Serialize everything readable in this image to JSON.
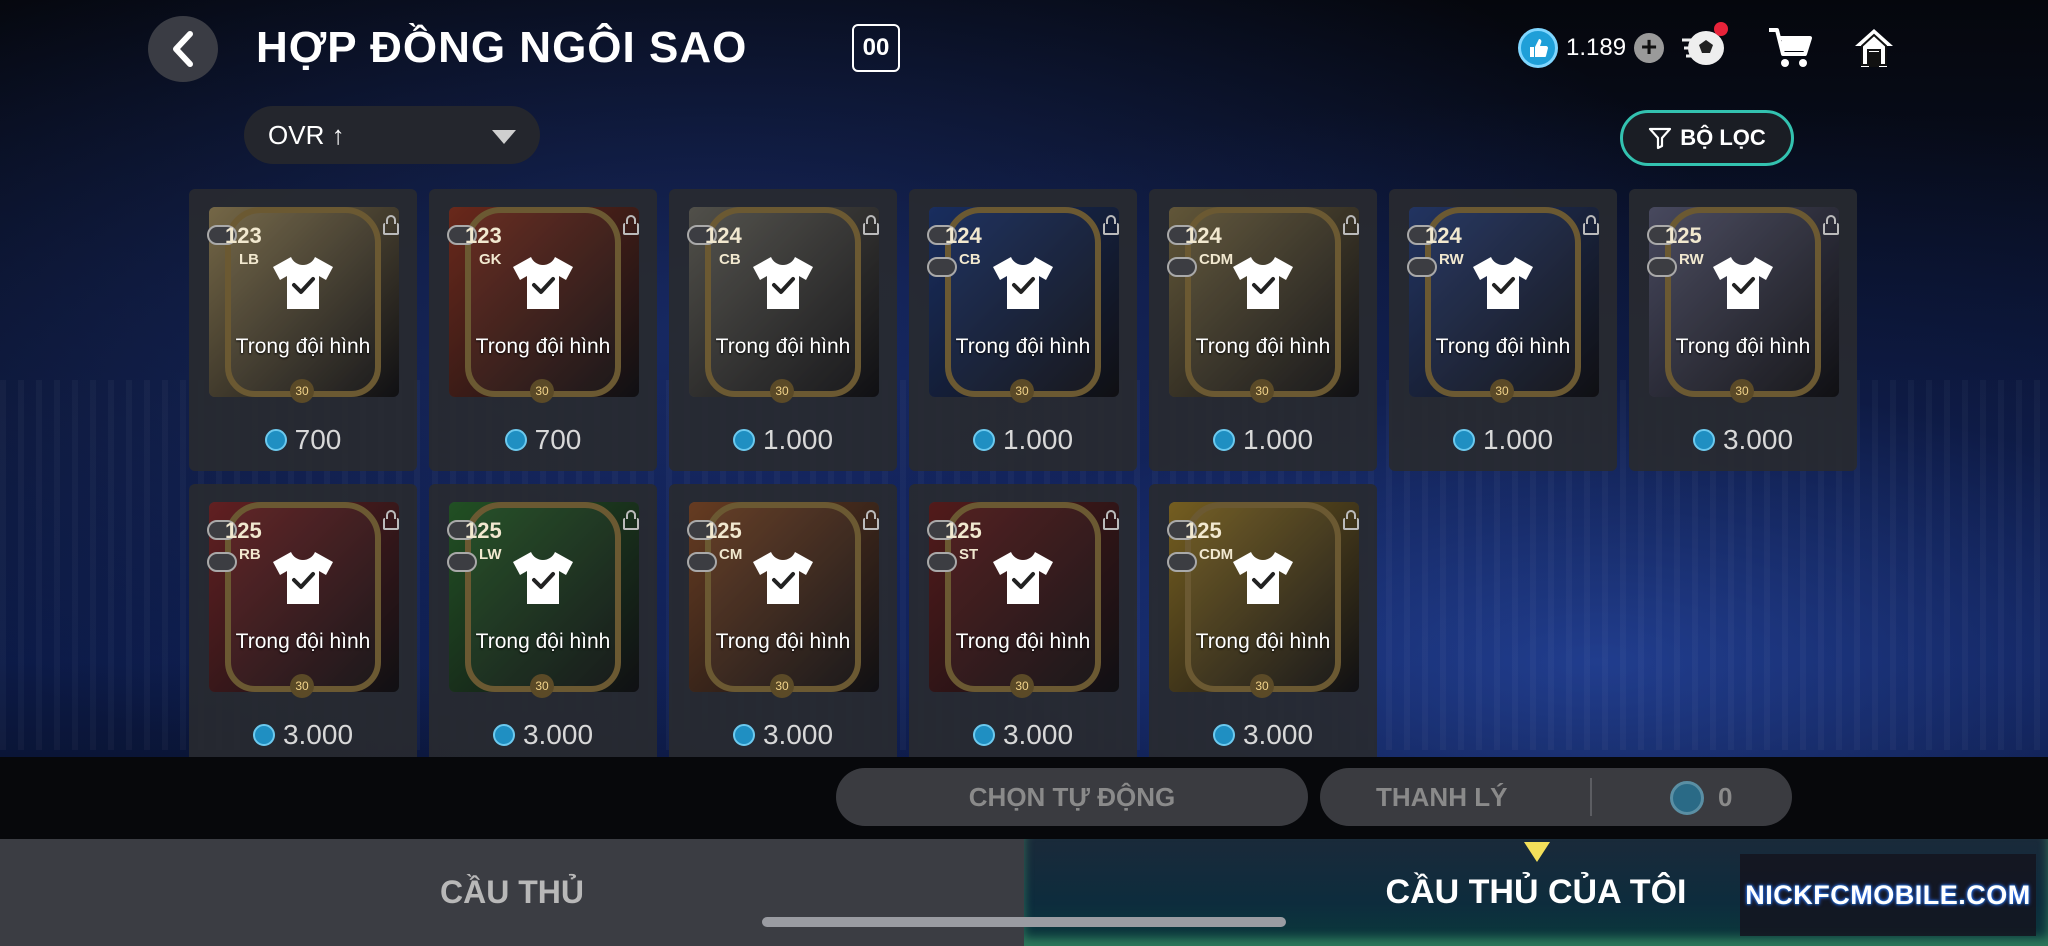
{
  "header": {
    "title": "HỢP ĐỒNG NGÔI SAO",
    "badge": "00",
    "currency_amount": "1.189",
    "icons": [
      "back-icon",
      "coin-icon",
      "plus-icon",
      "ball-icon",
      "cart-icon",
      "home-icon"
    ]
  },
  "sort": {
    "label": "OVR ↑"
  },
  "filter": {
    "label": "BỘ LỌC"
  },
  "cards": [
    {
      "ovr": "123",
      "position": "LB",
      "level": "30",
      "status": "Trong đội hình",
      "price": "700",
      "tint": "#c9b27a"
    },
    {
      "ovr": "123",
      "position": "GK",
      "level": "30",
      "status": "Trong đội hình",
      "price": "700",
      "tint": "#b6462f"
    },
    {
      "ovr": "124",
      "position": "CB",
      "level": "30",
      "status": "Trong đội hình",
      "price": "1.000",
      "tint": "#8c8a80"
    },
    {
      "ovr": "124",
      "position": "CB",
      "level": "30",
      "status": "Trong đội hình",
      "price": "1.000",
      "tint": "#2b4fa4"
    },
    {
      "ovr": "124",
      "position": "CDM",
      "level": "30",
      "status": "Trong đội hình",
      "price": "1.000",
      "tint": "#a89562"
    },
    {
      "ovr": "124",
      "position": "RW",
      "level": "30",
      "status": "Trong đội hình",
      "price": "1.000",
      "tint": "#3b5aa8"
    },
    {
      "ovr": "125",
      "position": "RW",
      "level": "30",
      "status": "Trong đội hình",
      "price": "3.000",
      "tint": "#7c7ea3"
    },
    {
      "ovr": "125",
      "position": "RB",
      "level": "30",
      "status": "Trong đội hình",
      "price": "3.000",
      "tint": "#a8373a"
    },
    {
      "ovr": "125",
      "position": "LW",
      "level": "30",
      "status": "Trong đội hình",
      "price": "3.000",
      "tint": "#3a8a3e"
    },
    {
      "ovr": "125",
      "position": "CM",
      "level": "30",
      "status": "Trong đội hình",
      "price": "3.000",
      "tint": "#b0673a"
    },
    {
      "ovr": "125",
      "position": "ST",
      "level": "30",
      "status": "Trong đội hình",
      "price": "3.000",
      "tint": "#8e2e2e"
    },
    {
      "ovr": "125",
      "position": "CDM",
      "level": "30",
      "status": "Trong đội hình",
      "price": "3.000",
      "tint": "#c9a238"
    }
  ],
  "actions": {
    "auto_select": "CHỌN TỰ ĐỘNG",
    "sell": "THANH LÝ",
    "sell_count": "0"
  },
  "tabs": {
    "players": "CẦU THỦ",
    "my_players": "CẦU THỦ CỦA TÔI"
  },
  "watermark": "NICKFCMOBILE.COM",
  "colors": {
    "accent_teal": "#33c2b0",
    "coin_blue": "#1f9fd8",
    "indicator_yellow": "#f3e05a",
    "notification_red": "#e8233a"
  }
}
